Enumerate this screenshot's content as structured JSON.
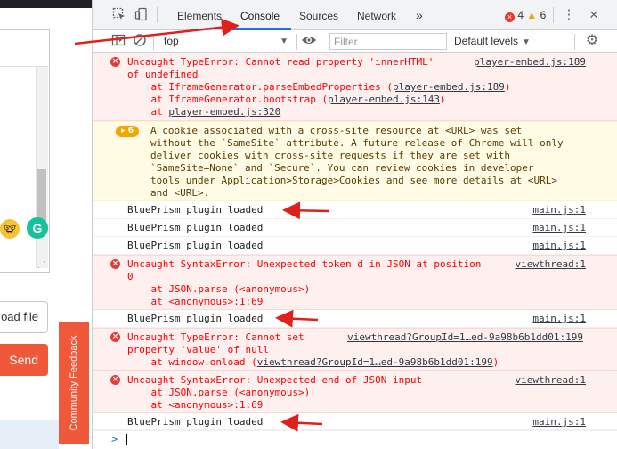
{
  "page": {
    "upload_label": "oad file",
    "send_label": "Send",
    "community_feedback": "Community Feedback",
    "emoji_glyph": "🤓",
    "grammarly_glyph": "G",
    "resize_glyph": "⋰"
  },
  "devtools": {
    "tabs": [
      "Elements",
      "Console",
      "Sources",
      "Network"
    ],
    "active_tab": "Console",
    "more_tabs_glyph": "»",
    "error_count": "4",
    "warning_count": "6",
    "menu_glyph": "⋮",
    "close_glyph": "✕",
    "toolbar": {
      "context": "top",
      "filter_placeholder": "Filter",
      "levels": "Default levels"
    },
    "messages": [
      {
        "type": "error",
        "lines": [
          "Uncaught TypeError: Cannot read property 'innerHTML'",
          "of undefined",
          "    at IframeGenerator.parseEmbedProperties (",
          "    at IframeGenerator.bootstrap (",
          "    at "
        ],
        "stack_links": [
          "player-embed.js:189",
          "player-embed.js:143",
          "player-embed.js:320"
        ],
        "source": "player-embed.js:189"
      },
      {
        "type": "warn",
        "badge": "6",
        "lines": [
          "A cookie associated with a cross-site resource at <URL> was set",
          "without the `SameSite` attribute. A future release of Chrome will only",
          "deliver cookies with cross-site requests if they are set with",
          "`SameSite=None` and `Secure`. You can review cookies in developer",
          "tools under Application>Storage>Cookies and see more details at <URL>",
          "and <URL>."
        ]
      },
      {
        "type": "log",
        "text": "BluePrism plugin loaded",
        "source": "main.js:1"
      },
      {
        "type": "log",
        "text": "BluePrism plugin loaded",
        "source": "main.js:1"
      },
      {
        "type": "log",
        "text": "BluePrism plugin loaded",
        "source": "main.js:1"
      },
      {
        "type": "error",
        "lines": [
          "Uncaught SyntaxError: Unexpected token d in JSON at position",
          "0",
          "    at JSON.parse (<anonymous>)",
          "    at <anonymous>:1:69"
        ],
        "source": "viewthread:1"
      },
      {
        "type": "log",
        "text": "BluePrism plugin loaded",
        "source": "main.js:1"
      },
      {
        "type": "error",
        "lines": [
          "Uncaught TypeError: Cannot set",
          "property 'value' of null",
          "    at window.onload ("
        ],
        "stack_links": [
          "viewthread?GroupId=1…ed-9a98b6b1dd01:199"
        ],
        "source": "viewthread?GroupId=1…ed-9a98b6b1dd01:199"
      },
      {
        "type": "error",
        "lines": [
          "Uncaught SyntaxError: Unexpected end of JSON input",
          "    at JSON.parse (<anonymous>)",
          "    at <anonymous>:1:69"
        ],
        "source": "viewthread:1"
      },
      {
        "type": "log",
        "text": "BluePrism plugin loaded",
        "source": "main.js:1"
      }
    ],
    "prompt_glyph": ">"
  },
  "colors": {
    "error_bg": "#fff0f0",
    "error_text": "#ff0000",
    "warn_bg": "#fffbe5",
    "accent_blue": "#1a73e8",
    "send_orange": "#f0583a",
    "annotation_red": "#e0201a"
  }
}
